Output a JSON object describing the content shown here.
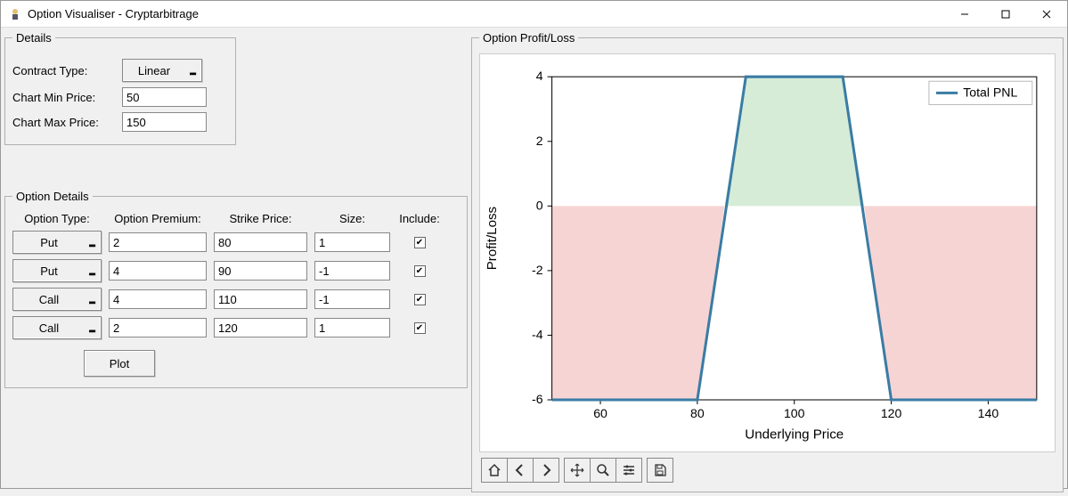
{
  "window": {
    "title": "Option Visualiser - Cryptarbitrage"
  },
  "details": {
    "legend": "Details",
    "contract_type_label": "Contract Type:",
    "contract_type_value": "Linear",
    "chart_min_label": "Chart Min Price:",
    "chart_min_value": "50",
    "chart_max_label": "Chart Max Price:",
    "chart_max_value": "150"
  },
  "option_details": {
    "legend": "Option Details",
    "headers": {
      "type": "Option Type:",
      "premium": "Option Premium:",
      "strike": "Strike Price:",
      "size": "Size:",
      "include": "Include:"
    },
    "rows": [
      {
        "type": "Put",
        "premium": "2",
        "strike": "80",
        "size": "1",
        "include": true
      },
      {
        "type": "Put",
        "premium": "4",
        "strike": "90",
        "size": "-1",
        "include": true
      },
      {
        "type": "Call",
        "premium": "4",
        "strike": "110",
        "size": "-1",
        "include": true
      },
      {
        "type": "Call",
        "premium": "2",
        "strike": "120",
        "size": "1",
        "include": true
      }
    ],
    "plot_label": "Plot"
  },
  "profit_loss": {
    "legend": "Option Profit/Loss"
  },
  "chart_data": {
    "type": "line",
    "title": "",
    "xlabel": "Underlying Price",
    "ylabel": "Profit/Loss",
    "xlim": [
      50,
      150
    ],
    "ylim": [
      -6,
      4
    ],
    "xticks": [
      60,
      80,
      100,
      120,
      140
    ],
    "yticks": [
      -6,
      -4,
      -2,
      0,
      2,
      4
    ],
    "series": [
      {
        "name": "Total PNL",
        "color": "#3a7ca5",
        "x": [
          50,
          80,
          90,
          110,
          120,
          150
        ],
        "y": [
          -6,
          -6,
          4,
          4,
          -6,
          -6
        ]
      }
    ],
    "fill_regions": [
      {
        "kind": "loss",
        "color": "#f7d4d4",
        "x": [
          50,
          80,
          85.6,
          50
        ],
        "y": [
          -6,
          -6,
          0,
          0
        ]
      },
      {
        "kind": "profit",
        "color": "#d6ecd6",
        "x": [
          85.6,
          90,
          110,
          114.4
        ],
        "y": [
          0,
          4,
          4,
          0
        ]
      },
      {
        "kind": "loss",
        "color": "#f7d4d4",
        "x": [
          114.4,
          120,
          150,
          150
        ],
        "y": [
          0,
          -6,
          -6,
          0
        ]
      }
    ],
    "legend": {
      "entries": [
        "Total PNL"
      ],
      "position": "upper right"
    }
  },
  "toolbar": {
    "home": "Home",
    "back": "Back",
    "forward": "Forward",
    "pan": "Pan",
    "zoom": "Zoom",
    "config": "Configure",
    "save": "Save"
  }
}
